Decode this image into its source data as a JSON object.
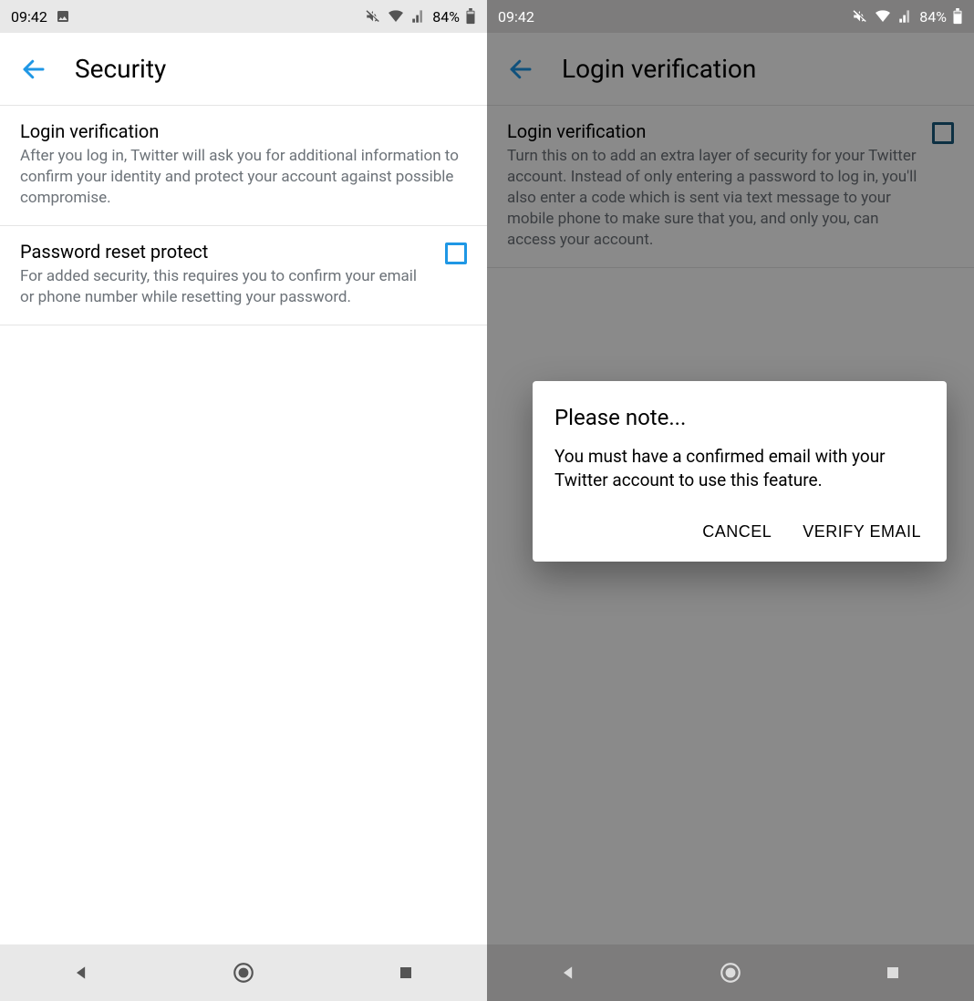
{
  "statusbar": {
    "time": "09:42",
    "battery_text": "84%"
  },
  "left": {
    "header": {
      "title": "Security"
    },
    "items": [
      {
        "title": "Login verification",
        "desc": "After you log in, Twitter will ask you for additional information to confirm your identity and protect your account against possible compromise."
      },
      {
        "title": "Password reset protect",
        "desc": "For added security, this requires you to confirm your email or phone number while resetting your password."
      }
    ]
  },
  "right": {
    "header": {
      "title": "Login verification"
    },
    "items": [
      {
        "title": "Login verification",
        "desc": "Turn this on to add an extra layer of security for your Twitter account. Instead of only entering a password to log in, you'll also enter a code which is sent via text message to your mobile phone to make sure that you, and only you, can access your account."
      }
    ],
    "dialog": {
      "title": "Please note...",
      "body": "You must have a confirmed email with your Twitter account to use this feature.",
      "cancel": "CANCEL",
      "confirm": "VERIFY EMAIL"
    }
  }
}
